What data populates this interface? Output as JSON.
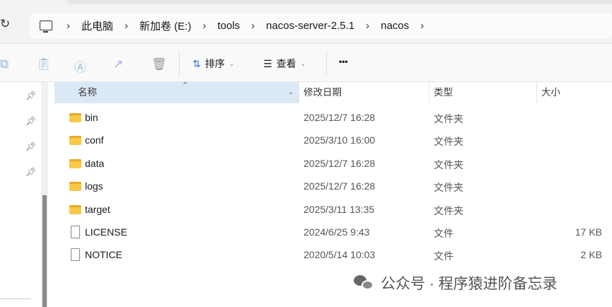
{
  "breadcrumb": [
    "此电脑",
    "新加卷 (E:)",
    "tools",
    "nacos-server-2.5.1",
    "nacos"
  ],
  "toolbar": {
    "sort_label": "排序",
    "view_label": "查看",
    "more_label": "•••"
  },
  "columns": {
    "name": "名称",
    "date": "修改日期",
    "type": "类型",
    "size": "大小"
  },
  "files": [
    {
      "name": "bin",
      "date": "2025/12/7 16:28",
      "type": "文件夹",
      "size": "",
      "kind": "folder"
    },
    {
      "name": "conf",
      "date": "2025/3/10 16:00",
      "type": "文件夹",
      "size": "",
      "kind": "folder"
    },
    {
      "name": "data",
      "date": "2025/12/7 16:28",
      "type": "文件夹",
      "size": "",
      "kind": "folder"
    },
    {
      "name": "logs",
      "date": "2025/12/7 16:28",
      "type": "文件夹",
      "size": "",
      "kind": "folder"
    },
    {
      "name": "target",
      "date": "2025/3/11 13:35",
      "type": "文件夹",
      "size": "",
      "kind": "folder"
    },
    {
      "name": "LICENSE",
      "date": "2024/6/25 9:43",
      "type": "文件",
      "size": "17 KB",
      "kind": "file"
    },
    {
      "name": "NOTICE",
      "date": "2020/5/14 10:03",
      "type": "文件",
      "size": "2 KB",
      "kind": "file"
    }
  ],
  "watermark": "公众号 · 程序猿进阶备忘录"
}
